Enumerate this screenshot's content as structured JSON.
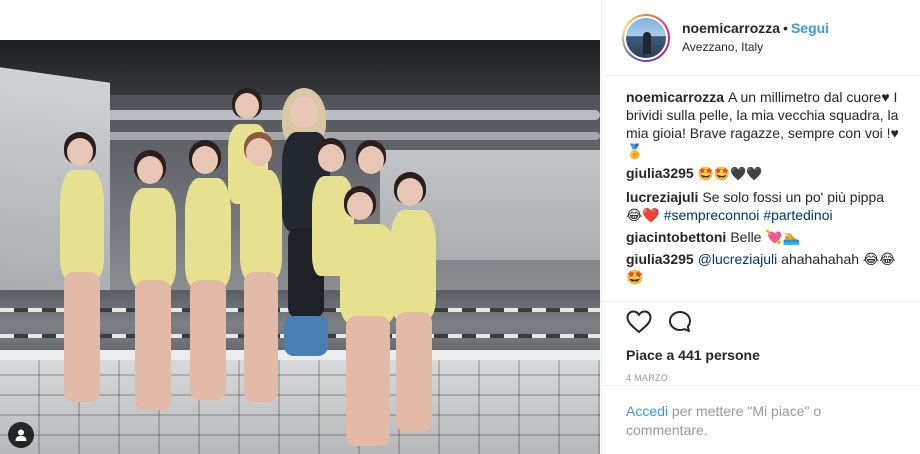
{
  "post": {
    "photo_alt": "",
    "image_badge_icon": "user-tag-icon"
  },
  "header": {
    "username": "noemicarrozza",
    "separator": "•",
    "follow_label": "Segui",
    "location": "Avezzano, Italy"
  },
  "caption": {
    "username": "noemicarrozza",
    "text": "A un millimetro dal cuore♥ I brividi sulla pelle, la mia vecchia squadra, la mia gioia! Brave ragazze, sempre con voi !♥🏅"
  },
  "comments": [
    {
      "username": "giulia3295",
      "text": "🤩🤩🖤🖤"
    },
    {
      "username": "lucreziajuli",
      "text": "Se solo fossi un po' più pippa 😂❤️",
      "tags": [
        "#sempreconnoi",
        "#partedinoi"
      ]
    },
    {
      "username": "giacintobettoni",
      "text": "Belle 💘🏊"
    },
    {
      "username": "giulia3295",
      "mention": "@lucreziajuli",
      "text": "ahahahahah 😂😂🤩"
    }
  ],
  "actions": {
    "like_icon": "heart-icon",
    "comment_icon": "comment-icon"
  },
  "likes_text": "Piace a 441 persone",
  "date": "4 MARZO",
  "login_prompt": {
    "link": "Accedi",
    "text": " per mettere \"Mi piace\" o commentare."
  },
  "colors": {
    "link_blue": "#3897f0",
    "hashtag_blue": "#003569",
    "divider": "#efefef"
  }
}
